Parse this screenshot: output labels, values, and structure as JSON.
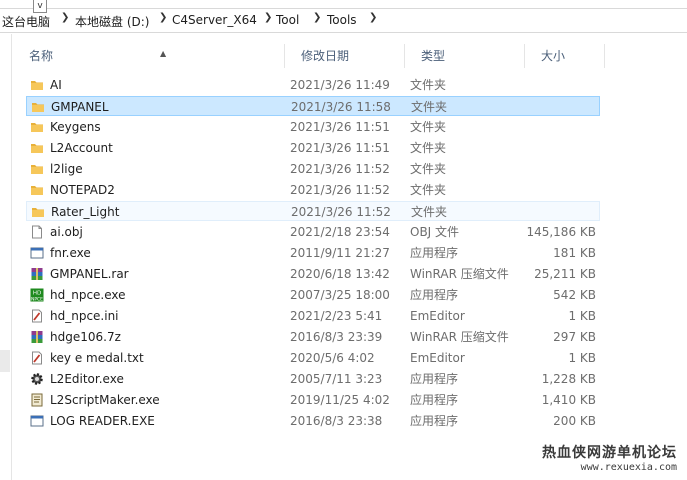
{
  "address": {
    "dropdown_glyph": "v",
    "crumbs": [
      "这台电脑",
      "本地磁盘 (D:)",
      "C4Server_X64",
      "Tool",
      "Tools"
    ]
  },
  "columns": {
    "name": "名称",
    "date": "修改日期",
    "type": "类型",
    "size": "大小"
  },
  "files": [
    {
      "name": "AI",
      "date": "2021/3/26 11:49",
      "type": "文件夹",
      "size": "",
      "icon": "folder-icon",
      "state": ""
    },
    {
      "name": "GMPANEL",
      "date": "2021/3/26 11:58",
      "type": "文件夹",
      "size": "",
      "icon": "folder-icon",
      "state": "selected"
    },
    {
      "name": "Keygens",
      "date": "2021/3/26 11:51",
      "type": "文件夹",
      "size": "",
      "icon": "folder-icon",
      "state": ""
    },
    {
      "name": "L2Account",
      "date": "2021/3/26 11:51",
      "type": "文件夹",
      "size": "",
      "icon": "folder-icon",
      "state": ""
    },
    {
      "name": "l2lige",
      "date": "2021/3/26 11:52",
      "type": "文件夹",
      "size": "",
      "icon": "folder-icon",
      "state": ""
    },
    {
      "name": "NOTEPAD2",
      "date": "2021/3/26 11:52",
      "type": "文件夹",
      "size": "",
      "icon": "folder-icon",
      "state": ""
    },
    {
      "name": "Rater_Light",
      "date": "2021/3/26 11:52",
      "type": "文件夹",
      "size": "",
      "icon": "folder-icon",
      "state": "hot"
    },
    {
      "name": "ai.obj",
      "date": "2021/2/18 23:54",
      "type": "OBJ 文件",
      "size": "145,186 KB",
      "icon": "file-icon",
      "state": ""
    },
    {
      "name": "fnr.exe",
      "date": "2011/9/11 21:27",
      "type": "应用程序",
      "size": "181 KB",
      "icon": "app-window-icon",
      "state": ""
    },
    {
      "name": "GMPANEL.rar",
      "date": "2020/6/18 13:42",
      "type": "WinRAR 压缩文件",
      "size": "25,211 KB",
      "icon": "winrar-archive-icon",
      "state": ""
    },
    {
      "name": "hd_npce.exe",
      "date": "2007/3/25 18:00",
      "type": "应用程序",
      "size": "542 KB",
      "icon": "hd-npc-app-icon",
      "state": ""
    },
    {
      "name": "hd_npce.ini",
      "date": "2021/2/23 5:41",
      "type": "EmEditor",
      "size": "1 KB",
      "icon": "emeditor-file-icon",
      "state": ""
    },
    {
      "name": "hdge106.7z",
      "date": "2016/8/3 23:39",
      "type": "WinRAR 压缩文件",
      "size": "297 KB",
      "icon": "winrar-archive-icon",
      "state": ""
    },
    {
      "name": "key e medal.txt",
      "date": "2020/5/6 4:02",
      "type": "EmEditor",
      "size": "1 KB",
      "icon": "emeditor-file-icon",
      "state": ""
    },
    {
      "name": "L2Editor.exe",
      "date": "2005/7/11 3:23",
      "type": "应用程序",
      "size": "1,228 KB",
      "icon": "gear-app-icon",
      "state": ""
    },
    {
      "name": "L2ScriptMaker.exe",
      "date": "2019/11/25 4:02",
      "type": "应用程序",
      "size": "1,410 KB",
      "icon": "script-app-icon",
      "state": ""
    },
    {
      "name": "LOG READER.EXE",
      "date": "2016/8/3 23:38",
      "type": "应用程序",
      "size": "200 KB",
      "icon": "app-window-icon",
      "state": ""
    }
  ],
  "watermark": {
    "text": "热血侠网游单机论坛",
    "url": "www.rexuexia.com"
  },
  "colors": {
    "selected_bg": "#cce8ff",
    "selected_border": "#99d1ff",
    "folder": "#f6c75a",
    "header_text": "#4c607a"
  }
}
